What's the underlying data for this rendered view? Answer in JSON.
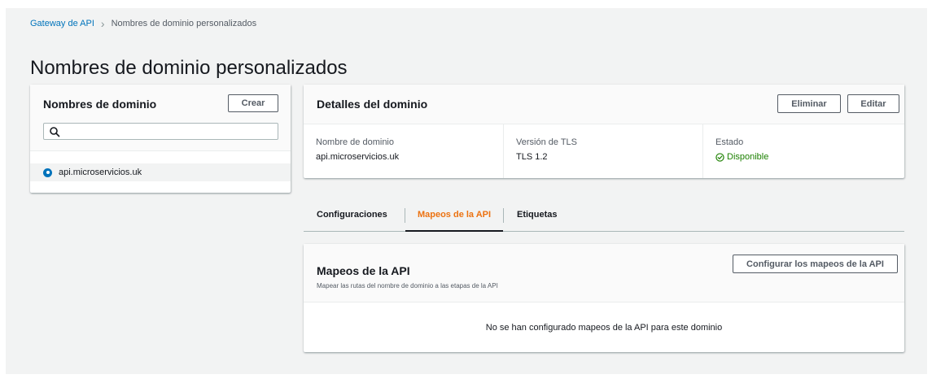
{
  "breadcrumb": {
    "root": "Gateway de API",
    "current": "Nombres de dominio personalizados"
  },
  "page_title": "Nombres de dominio personalizados",
  "domain_list": {
    "title": "Nombres de dominio",
    "create_label": "Crear",
    "search_value": "",
    "search_icon": "search-icon",
    "items": [
      {
        "label": "api.microservicios.uk",
        "selected": true
      }
    ]
  },
  "details": {
    "title": "Detalles del dominio",
    "delete_label": "Eliminar",
    "edit_label": "Editar",
    "fields": {
      "domain_label": "Nombre de dominio",
      "domain_value": "api.microservicios.uk",
      "tls_label": "Versión de TLS",
      "tls_value": "TLS 1.2",
      "status_label": "Estado",
      "status_value": "Disponible",
      "status_icon": "check-circle-icon"
    }
  },
  "tabs": [
    {
      "label": "Configuraciones",
      "active": false
    },
    {
      "label": "Mapeos de la API",
      "active": true
    },
    {
      "label": "Etiquetas",
      "active": false
    }
  ],
  "mappings": {
    "title": "Mapeos de la API",
    "description": "Mapear las rutas del nombre de dominio a las etapas de la API",
    "configure_label": "Configurar los mapeos de la API",
    "empty_message": "No se han configurado mapeos de la API para este dominio"
  },
  "colors": {
    "link": "#0073bb",
    "active_tab": "#ec7211",
    "success": "#1d8102",
    "background": "#f2f3f3"
  }
}
